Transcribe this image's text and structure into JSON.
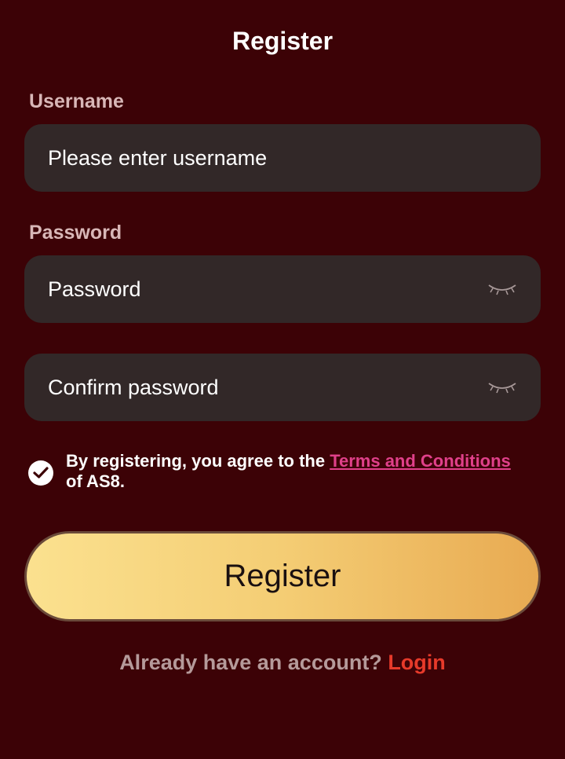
{
  "title": "Register",
  "username": {
    "label": "Username",
    "placeholder": "Please enter username",
    "value": ""
  },
  "password": {
    "label": "Password",
    "placeholder": "Password",
    "value": "",
    "toggle_icon": "eye-closed-icon"
  },
  "confirm_password": {
    "placeholder": "Confirm password",
    "value": "",
    "toggle_icon": "eye-closed-icon"
  },
  "agreement": {
    "checked": true,
    "text_before": "By registering, you agree to the ",
    "terms_link": "Terms and Conditions",
    "text_after": " of AS8."
  },
  "register_button": "Register",
  "footer": {
    "prompt": "Already have an account? ",
    "login_link": "Login"
  },
  "colors": {
    "background": "#3c0206",
    "field_bg": "#322828",
    "terms_link": "#e0408a",
    "login_link": "#e73a2a",
    "button_gradient_start": "#fbe18f",
    "button_gradient_end": "#e8aa52"
  }
}
